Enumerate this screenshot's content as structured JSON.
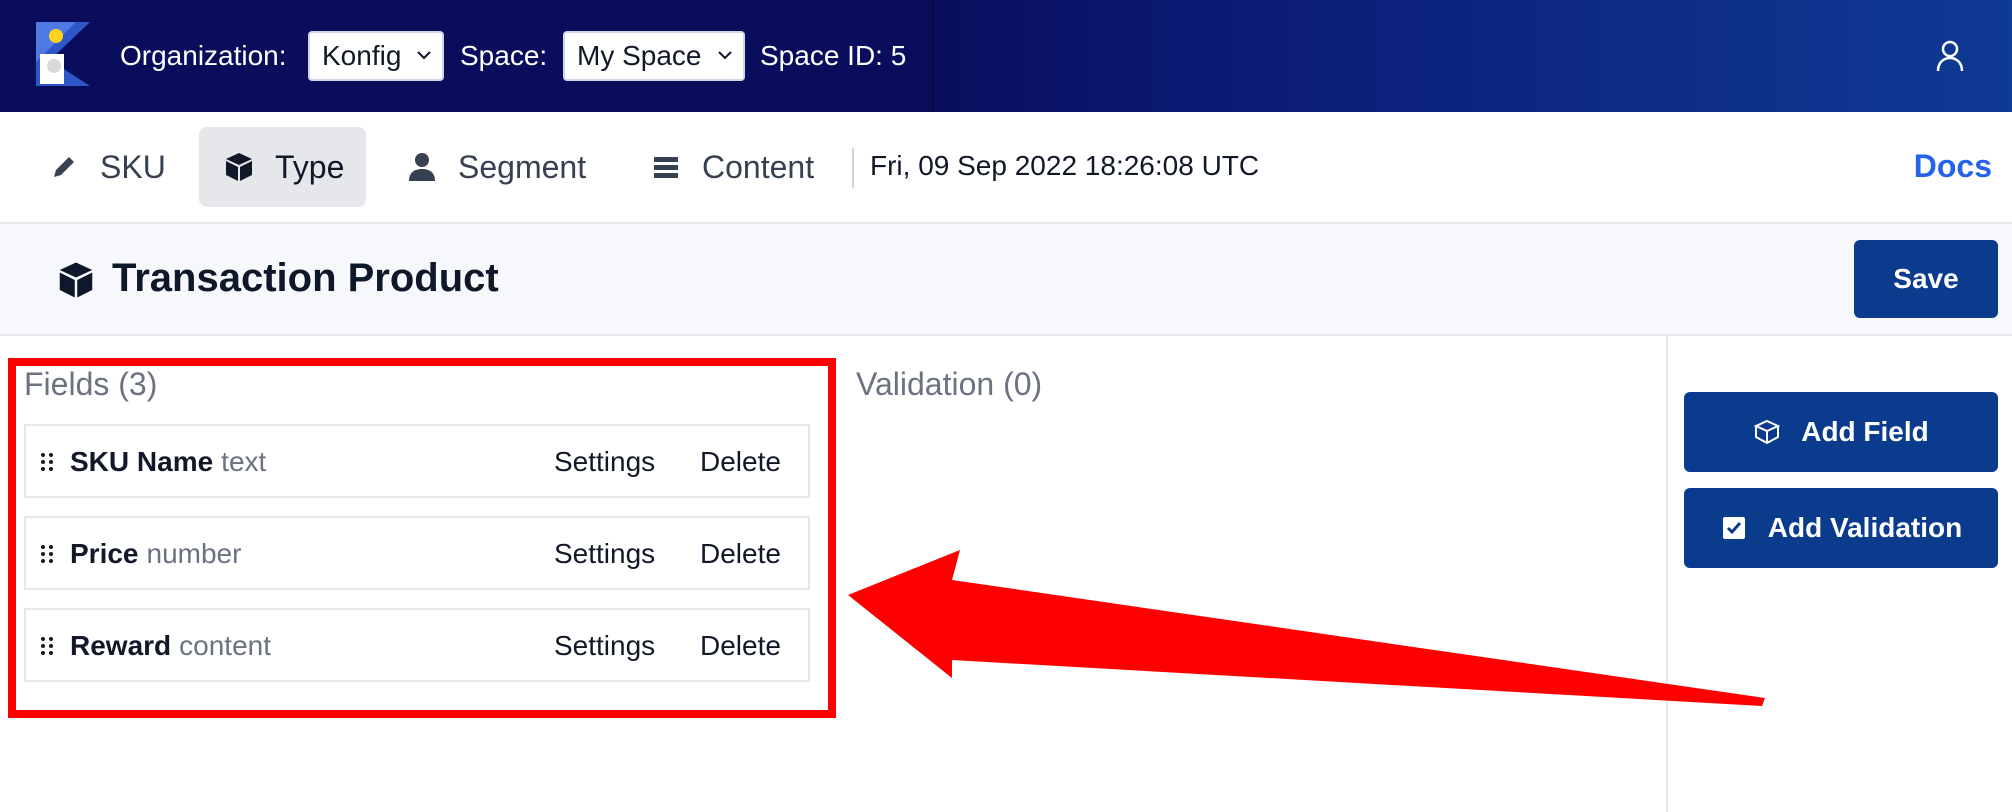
{
  "topbar": {
    "organization_label": "Organization:",
    "organization_value": "Konfig",
    "space_label": "Space:",
    "space_value": "My Space",
    "space_id": "Space ID: 5"
  },
  "nav": {
    "tabs": [
      {
        "label": "SKU",
        "icon": "pencil-icon",
        "active": false
      },
      {
        "label": "Type",
        "icon": "cube-icon",
        "active": true
      },
      {
        "label": "Segment",
        "icon": "person-icon",
        "active": false
      },
      {
        "label": "Content",
        "icon": "list-icon",
        "active": false
      }
    ],
    "timestamp": "Fri, 09 Sep 2022 18:26:08 UTC",
    "docs_label": "Docs"
  },
  "header": {
    "title": "Transaction Product",
    "save_label": "Save"
  },
  "fields": {
    "title": "Fields (3)",
    "items": [
      {
        "name": "SKU Name",
        "type": "text",
        "settings_label": "Settings",
        "delete_label": "Delete"
      },
      {
        "name": "Price",
        "type": "number",
        "settings_label": "Settings",
        "delete_label": "Delete"
      },
      {
        "name": "Reward",
        "type": "content",
        "settings_label": "Settings",
        "delete_label": "Delete"
      }
    ]
  },
  "validation": {
    "title": "Validation (0)"
  },
  "sidebar": {
    "add_field_label": "Add Field",
    "add_validation_label": "Add Validation"
  },
  "colors": {
    "topbar": "#0a0d5c",
    "primary_button": "#0b3b8c",
    "docs_link": "#2563eb",
    "annotation": "#ff0000"
  }
}
